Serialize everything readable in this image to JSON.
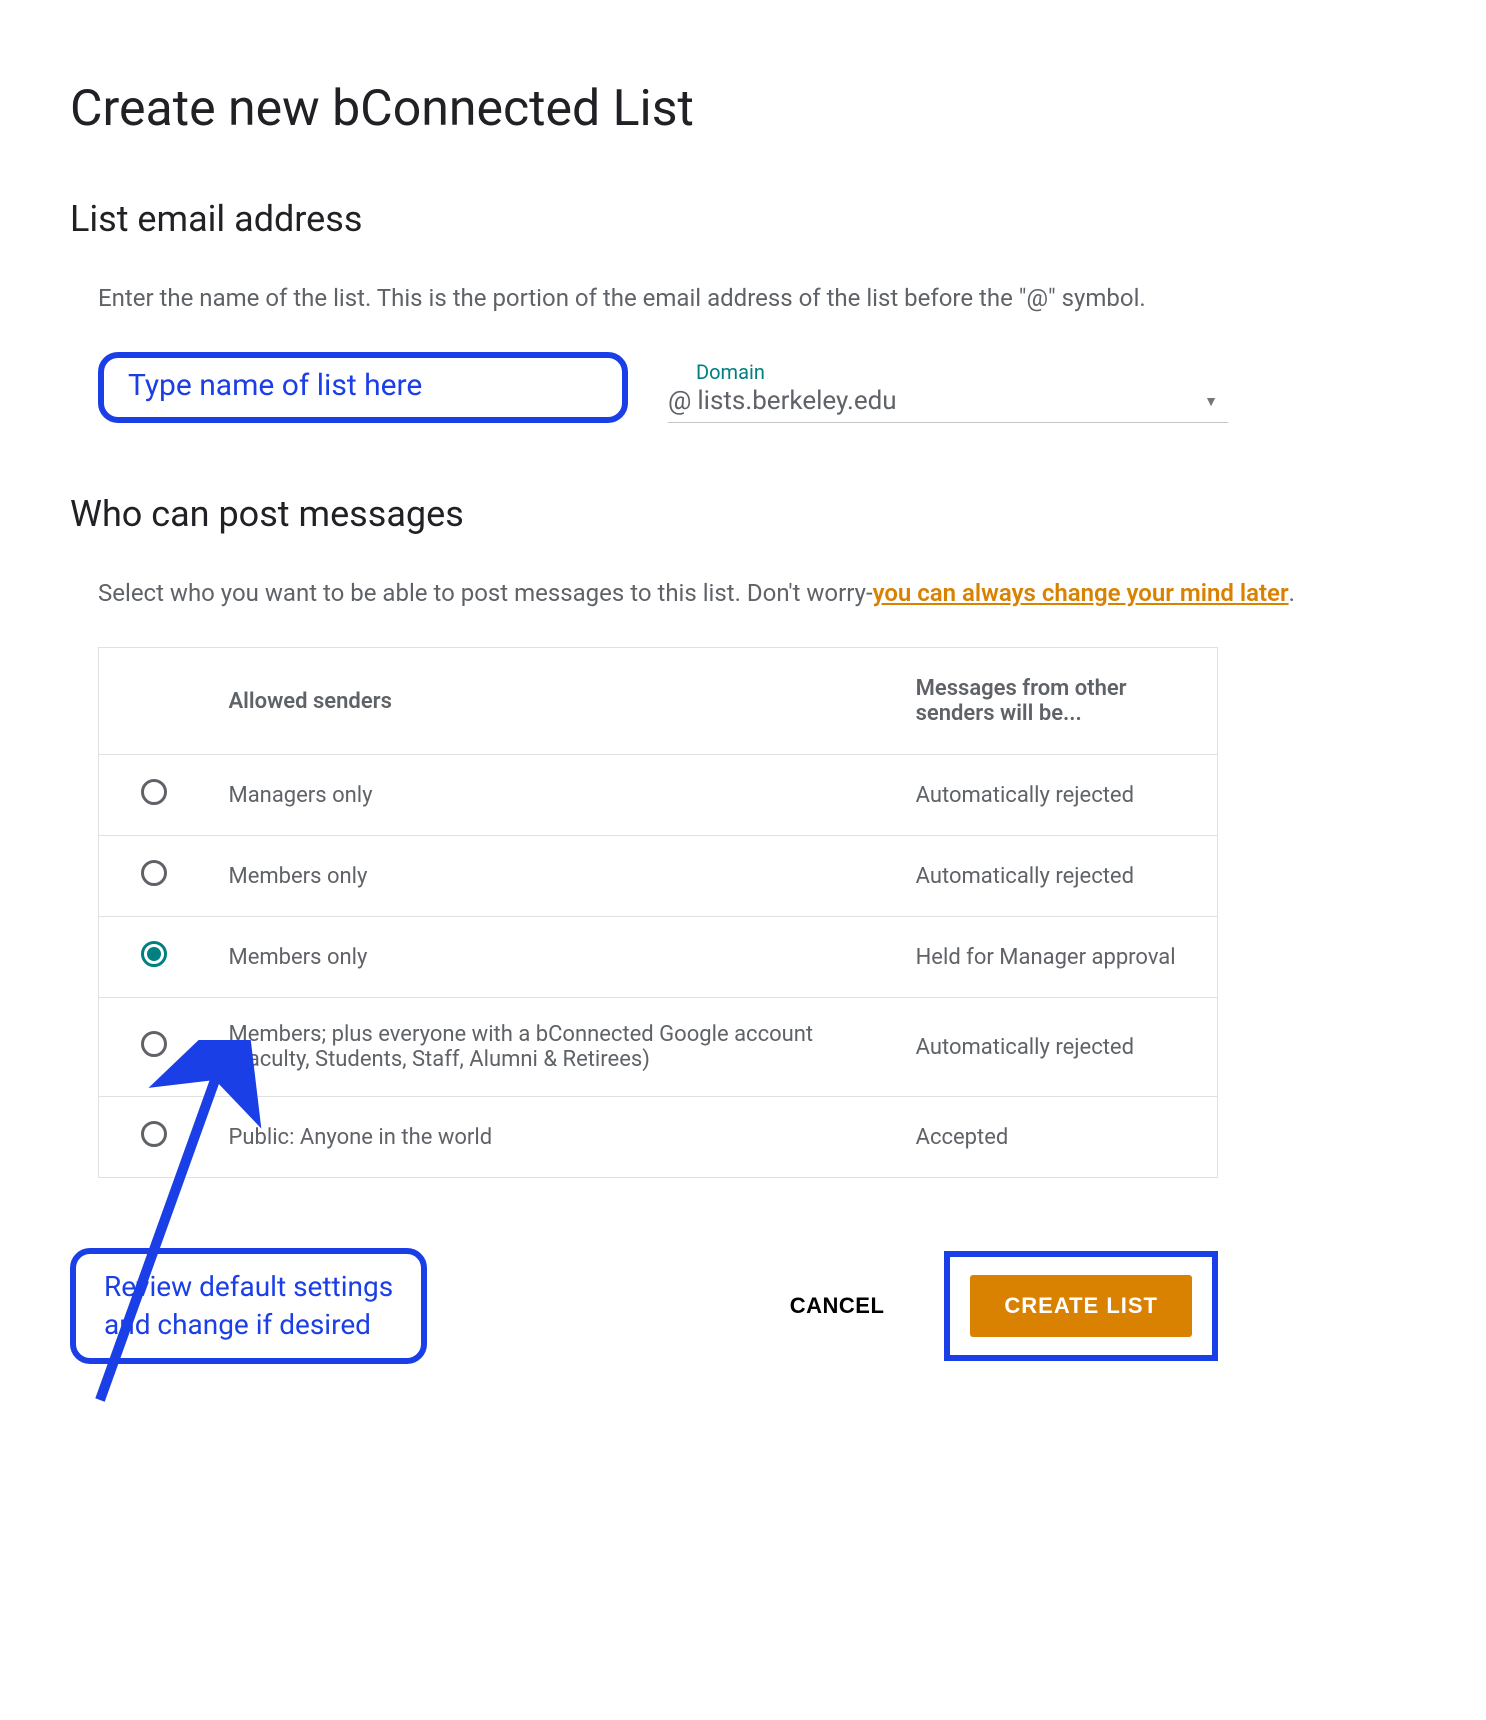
{
  "page_title": "Create new bConnected List",
  "section_email": {
    "heading": "List email address",
    "helper": "Enter the name of the list. This is the portion of the email address of the list before the \"@\" symbol.",
    "name_placeholder_annotation": "Type name of list here",
    "domain_label": "Domain",
    "at_symbol": "@",
    "domain_value": "lists.berkeley.edu"
  },
  "section_post": {
    "heading": "Who can post messages",
    "helper_prefix": "Select who you want to be able to post messages to this list. Don't worry-",
    "helper_link": "you can always change your mind later",
    "helper_suffix": ".",
    "col_senders": "Allowed senders",
    "col_other": "Messages from other senders will be...",
    "options": [
      {
        "senders": "Managers only",
        "other": "Automatically rejected",
        "selected": false
      },
      {
        "senders": "Members only",
        "other": "Automatically rejected",
        "selected": false
      },
      {
        "senders": "Members only",
        "other": "Held for Manager approval",
        "selected": true
      },
      {
        "senders": "Members; plus everyone with a bConnected Google account (Faculty, Students, Staff, Alumni & Retirees)",
        "other": "Automatically rejected",
        "selected": false
      },
      {
        "senders": "Public: Anyone in the world",
        "other": "Accepted",
        "selected": false
      }
    ]
  },
  "annotations": {
    "review": "Review default settings\nand change if desired"
  },
  "buttons": {
    "cancel": "CANCEL",
    "create": "CREATE LIST"
  },
  "colors": {
    "annotation_blue": "#1a3fe6",
    "accent_teal": "#008080",
    "brand_orange": "#d98100"
  }
}
